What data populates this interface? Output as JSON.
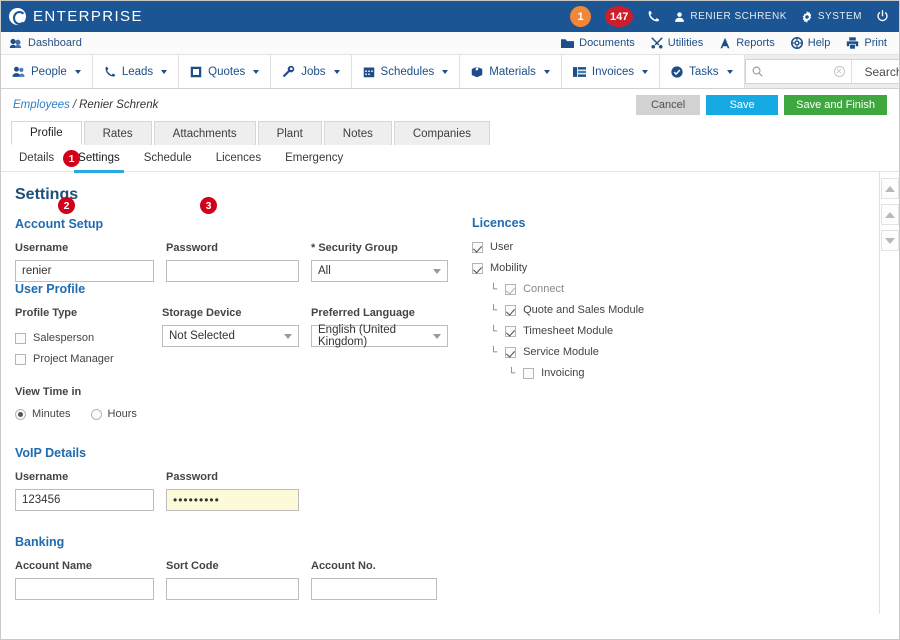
{
  "topbar": {
    "brand": "ENTERPRISE",
    "badge_alert": "1",
    "badge_notifications": "147",
    "user_name": "RENIER SCHRENK",
    "system_label": "SYSTEM",
    "icons": {
      "logo": "enterprise-logo-icon",
      "phone": "phone-icon",
      "user": "user-icon",
      "gear": "gear-icon",
      "power": "power-icon"
    },
    "colors": {
      "bar": "#1b5593",
      "badge_alert": "#f0873b",
      "badge_notifications": "#cc1f2b"
    }
  },
  "utilbar": {
    "dashboard": "Dashboard",
    "links": [
      {
        "label": "Documents",
        "icon": "folder-icon"
      },
      {
        "label": "Utilities",
        "icon": "tools-icon"
      },
      {
        "label": "Reports",
        "icon": "chart-icon"
      },
      {
        "label": "Help",
        "icon": "lifebuoy-icon"
      },
      {
        "label": "Print",
        "icon": "printer-icon"
      }
    ]
  },
  "nav": {
    "items": [
      {
        "label": "People",
        "icon": "people-icon"
      },
      {
        "label": "Leads",
        "icon": "phone-icon"
      },
      {
        "label": "Quotes",
        "icon": "document-icon"
      },
      {
        "label": "Jobs",
        "icon": "wrench-icon"
      },
      {
        "label": "Schedules",
        "icon": "calendar-icon"
      },
      {
        "label": "Materials",
        "icon": "box-icon"
      },
      {
        "label": "Invoices",
        "icon": "invoice-icon"
      },
      {
        "label": "Tasks",
        "icon": "check-circle-icon"
      }
    ],
    "search": {
      "value": "",
      "placeholder": "",
      "button_label": "Search",
      "icon": "search-icon",
      "clear_icon": "clear-icon",
      "bookmark_icon": "bookmark-icon"
    }
  },
  "breadcrumb": {
    "parent": "Employees",
    "separator": "/",
    "current": "Renier Schrenk"
  },
  "actions": {
    "cancel": "Cancel",
    "save": "Save",
    "save_and_finish": "Save and Finish",
    "colors": {
      "cancel": "#d2d2d2",
      "save": "#16aae5",
      "save_and_finish": "#3ea83e"
    }
  },
  "tabs": [
    {
      "label": "Profile",
      "active": true
    },
    {
      "label": "Rates",
      "active": false
    },
    {
      "label": "Attachments",
      "active": false
    },
    {
      "label": "Plant",
      "active": false
    },
    {
      "label": "Notes",
      "active": false
    },
    {
      "label": "Companies",
      "active": false
    }
  ],
  "subtabs": [
    {
      "label": "Details",
      "active": false
    },
    {
      "label": "Settings",
      "active": true
    },
    {
      "label": "Schedule",
      "active": false
    },
    {
      "label": "Licences",
      "active": false
    },
    {
      "label": "Emergency",
      "active": false
    }
  ],
  "markers": [
    {
      "number": "1",
      "target": "settings-subtab"
    },
    {
      "number": "2",
      "target": "voip-username-input"
    },
    {
      "number": "3",
      "target": "voip-password-input"
    }
  ],
  "page": {
    "title": "Settings"
  },
  "account_setup": {
    "heading": "Account Setup",
    "username_label": "Username",
    "username_value": "renier",
    "password_label": "Password",
    "password_value": "",
    "security_group_label": "* Security Group",
    "security_group_value": "All"
  },
  "user_profile": {
    "heading": "User Profile",
    "profile_type_label": "Profile Type",
    "profile_types": [
      {
        "label": "Salesperson",
        "checked": false
      },
      {
        "label": "Project Manager",
        "checked": false
      }
    ],
    "storage_device_label": "Storage Device",
    "storage_device_value": "Not Selected",
    "preferred_language_label": "Preferred Language",
    "preferred_language_value": "English (United Kingdom)",
    "view_time_label": "View Time in",
    "view_time_options": [
      {
        "label": "Minutes",
        "selected": true
      },
      {
        "label": "Hours",
        "selected": false
      }
    ]
  },
  "voip": {
    "heading": "VoIP Details",
    "username_label": "Username",
    "username_value": "123456",
    "password_label": "Password",
    "password_value": "•••••••••"
  },
  "banking": {
    "heading": "Banking",
    "account_name_label": "Account Name",
    "account_name_value": "",
    "sort_code_label": "Sort Code",
    "sort_code_value": "",
    "account_no_label": "Account No.",
    "account_no_value": ""
  },
  "licences": {
    "heading": "Licences",
    "items": [
      {
        "label": "User",
        "checked": true,
        "level": 1,
        "disabled": false
      },
      {
        "label": "Mobility",
        "checked": true,
        "level": 1,
        "disabled": false
      },
      {
        "label": "Connect",
        "checked": true,
        "level": 2,
        "disabled": true
      },
      {
        "label": "Quote and Sales Module",
        "checked": true,
        "level": 2,
        "disabled": false
      },
      {
        "label": "Timesheet Module",
        "checked": true,
        "level": 2,
        "disabled": false
      },
      {
        "label": "Service Module",
        "checked": true,
        "level": 2,
        "disabled": false
      },
      {
        "label": "Invoicing",
        "checked": false,
        "level": 3,
        "disabled": false
      }
    ]
  },
  "scroll_rail": {
    "buttons": [
      "scroll-top-icon",
      "scroll-up-icon",
      "scroll-down-icon"
    ]
  }
}
